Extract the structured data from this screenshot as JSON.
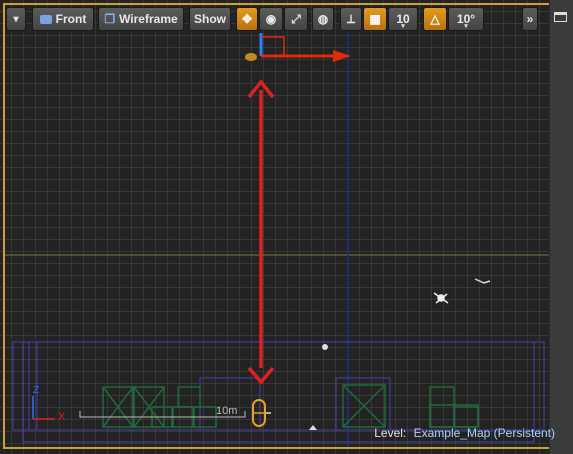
{
  "toolbar": {
    "view_mode_label": "Front",
    "render_mode_label": "Wireframe",
    "show_label": "Show",
    "grid_snap_value": "10",
    "rotation_snap_value": "10°"
  },
  "viewport": {
    "scale_label": "10m",
    "axis_labels": {
      "x": "X",
      "z": "Z"
    },
    "level": {
      "label": "Level:",
      "value": "Example_Map (Persistent)"
    }
  },
  "colors": {
    "accent": "#e08e12",
    "grid_origin_line": "#7a7a40",
    "vertical_axis_line": "#1f2a8a",
    "annotation_arrow": "#e02020",
    "gizmo_x": "#e02a0a",
    "gizmo_z": "#2f7dff",
    "mesh_wire": "#1f6b3a"
  },
  "icons": [
    "dropdown-arrow-icon",
    "perspective-icon",
    "wireframe-cube-icon",
    "translate-icon",
    "rotate-icon",
    "scale-icon",
    "world-local-icon",
    "surface-snap-icon",
    "grid-snap-icon",
    "rotation-snap-icon",
    "overflow-icon",
    "maximize-icon"
  ]
}
